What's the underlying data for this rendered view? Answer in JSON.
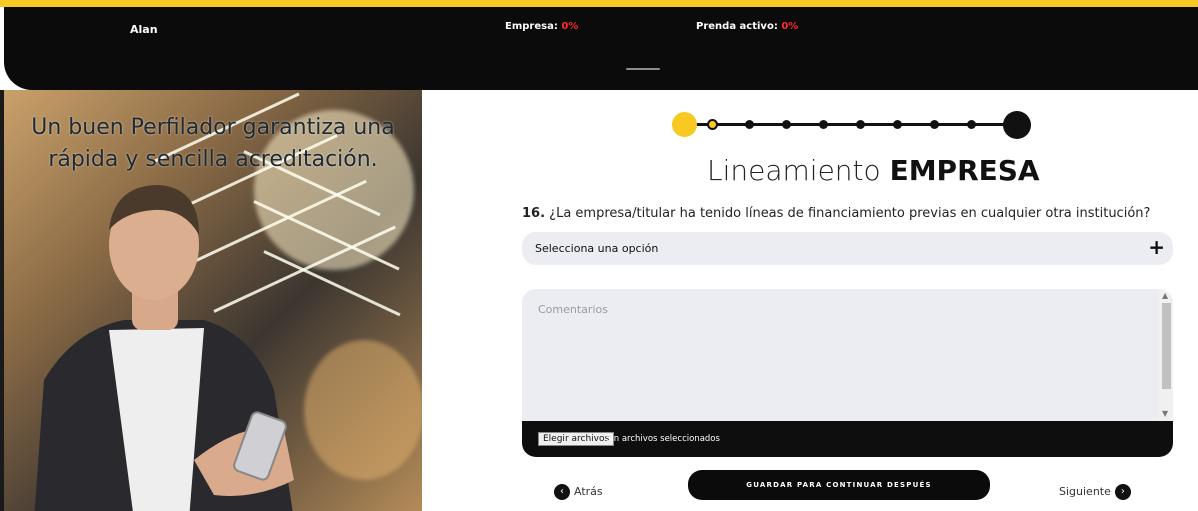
{
  "header": {
    "user_name": "Alan",
    "empresa_label": "Empresa:",
    "empresa_value": "0%",
    "prenda_label": "Prenda activo:",
    "prenda_value": "0%"
  },
  "hero": {
    "line1": "Un buen Perfilador garantiza una",
    "line2": "rápida y sencilla acreditación."
  },
  "stepper": {
    "total_steps": 10,
    "current_step": 1
  },
  "section": {
    "title_light": "Lineamiento",
    "title_bold": "EMPRESA"
  },
  "question": {
    "number": "16.",
    "text": "¿La empresa/titular ha tenido líneas de financiamiento previas en cualquier otra institución?"
  },
  "select": {
    "value": "Selecciona una opción",
    "icon": "plus-icon"
  },
  "comments": {
    "placeholder": "Comentarios"
  },
  "file": {
    "button_label": "Elegir archivos",
    "status": "Sin archivos seleccionados"
  },
  "nav": {
    "back_label": "Atrás",
    "save_label": "GUARDAR PARA CONTINUAR DESPUÉS",
    "next_label": "Siguiente"
  },
  "colors": {
    "accent": "#f7c922",
    "dark": "#0b0b0b",
    "alert": "#ff2a2a",
    "field": "#ecedf2"
  }
}
